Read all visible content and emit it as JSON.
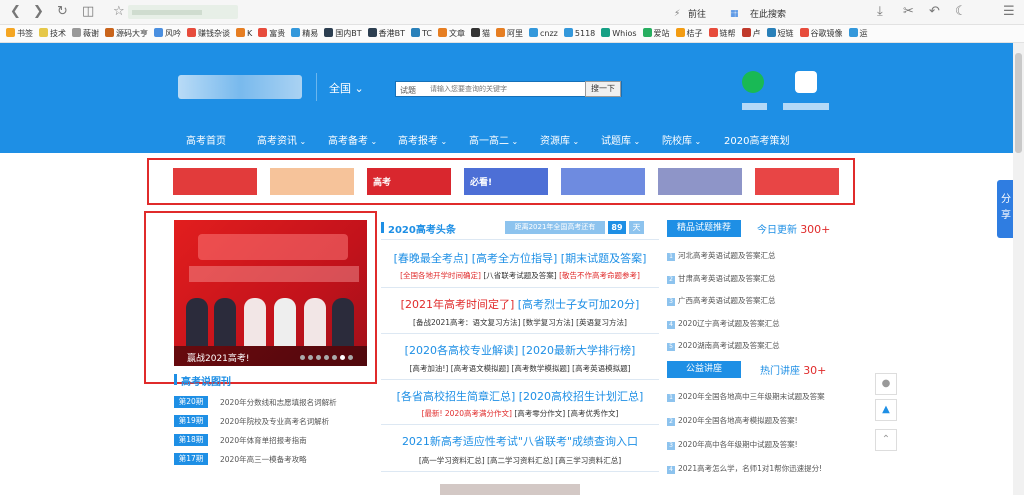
{
  "browser": {
    "forward_label": "前往",
    "search_label": "在此搜索",
    "bookmarks": [
      {
        "label": "书签",
        "color": "#f5a623"
      },
      {
        "label": "技术",
        "color": "#e6c84a"
      },
      {
        "label": "薇谢",
        "color": "#999999"
      },
      {
        "label": "源码大亨",
        "color": "#c9641b"
      },
      {
        "label": "风吟",
        "color": "#4a8fe0"
      },
      {
        "label": "赚钱杂谈",
        "color": "#e74c3c"
      },
      {
        "label": "K",
        "color": "#e67e22"
      },
      {
        "label": "富贵",
        "color": "#e74c3c"
      },
      {
        "label": "精易",
        "color": "#3498db"
      },
      {
        "label": "国内BT",
        "color": "#2c3e50"
      },
      {
        "label": "香港BT",
        "color": "#2c3e50"
      },
      {
        "label": "TC",
        "color": "#2980b9"
      },
      {
        "label": "文章",
        "color": "#e67e22"
      },
      {
        "label": "猫",
        "color": "#333333"
      },
      {
        "label": "阿里",
        "color": "#e67e22"
      },
      {
        "label": "cnzz",
        "color": "#3498db"
      },
      {
        "label": "5118",
        "color": "#3498db"
      },
      {
        "label": "Whios",
        "color": "#16a085"
      },
      {
        "label": "爱站",
        "color": "#27ae60"
      },
      {
        "label": "桔子",
        "color": "#f39c12"
      },
      {
        "label": "链帮",
        "color": "#e74c3c"
      },
      {
        "label": "卢",
        "color": "#c0392b"
      },
      {
        "label": "短链",
        "color": "#2980b9"
      },
      {
        "label": "谷歌镜像",
        "color": "#e74c3c"
      },
      {
        "label": "运",
        "color": "#3498db"
      }
    ]
  },
  "header": {
    "region": "全国",
    "search_select": "试题",
    "search_placeholder": "请输入您要查询的关键字",
    "search_button": "搜一下"
  },
  "nav": [
    "高考首页",
    "高考资讯",
    "高考备考",
    "高考报考",
    "高一高二",
    "资源库",
    "试题库",
    "院校库",
    "2020高考策划"
  ],
  "ads": [
    {
      "label": "",
      "color": "#e23b3b"
    },
    {
      "label": "",
      "color": "#f6c39a"
    },
    {
      "label": "高考",
      "color": "#d9272e"
    },
    {
      "label": "必看!",
      "color": "#4d6fd6"
    },
    {
      "label": "",
      "color": "#6e8be0"
    },
    {
      "label": "",
      "color": "#8e95c8"
    },
    {
      "label": "",
      "color": "#e84545"
    }
  ],
  "banner": {
    "caption": "赢战2021高考!"
  },
  "left_section": {
    "title": "高考说图刊",
    "issues": [
      {
        "badge": "第20期",
        "text": "2020年分数线和志愿填报名词解析"
      },
      {
        "badge": "第19期",
        "text": "2020年院校及专业高考名词解析"
      },
      {
        "badge": "第18期",
        "text": "2020年体育单招报考指南"
      },
      {
        "badge": "第17期",
        "text": "2020年高三一模备考攻略"
      }
    ]
  },
  "center": {
    "title": "2020高考头条",
    "countdown_label": "距离2021年全国高考还有",
    "countdown_days": "89",
    "countdown_unit": "天",
    "h1": "[春晚最全考点] [高考全方位指导] [期末试题及答案]",
    "s1a": "[全国各地开学时间确定]",
    "s1b": "[八省联考试题及答案]",
    "s1c": "[敬告不作高考命题参考]",
    "h2a": "[2021年高考时间定了]",
    "h2b": "[高考烈士子女可加20分]",
    "s2": "[备战2021高考：语文复习方法] [数学复习方法] [英语复习方法]",
    "h3": "[2020各高校专业解读] [2020最新大学排行榜]",
    "s3": "[高考加油!] [高考语文模拟题] [高考数学模拟题] [高考英语模拟题]",
    "h4": "[各省高校招生简章汇总] [2020高校招生计划汇总]",
    "s4a": "[最新! 2020高考满分作文]",
    "s4b": "[高考零分作文] [高考优秀作文]",
    "h5": "2021新高考适应性考试\"八省联考\"成绩查询入口",
    "s5": "[高一学习资料汇总] [高二学习资料汇总] [高三学习资料汇总]"
  },
  "right": {
    "tab1": "精品试题推荐",
    "update_label": "今日更新",
    "update_count": "300+",
    "list1": [
      "河北高考英语试题及答案汇总",
      "甘肃高考英语试题及答案汇总",
      "广西高考英语试题及答案汇总",
      "2020辽宁高考试题及答案汇总",
      "2020湖南高考试题及答案汇总"
    ],
    "tab2": "公益讲座",
    "lecture_label": "热门讲座",
    "lecture_count": "30+",
    "list2": [
      "2020年全国各地高中三年级期末试题及答案",
      "2020年全国各地高考模拟题及答案!",
      "2020年高中各年级期中试题及答案!",
      "2021高考怎么学，名师1对1帮你迅速提分!"
    ]
  },
  "share_label": "分享"
}
